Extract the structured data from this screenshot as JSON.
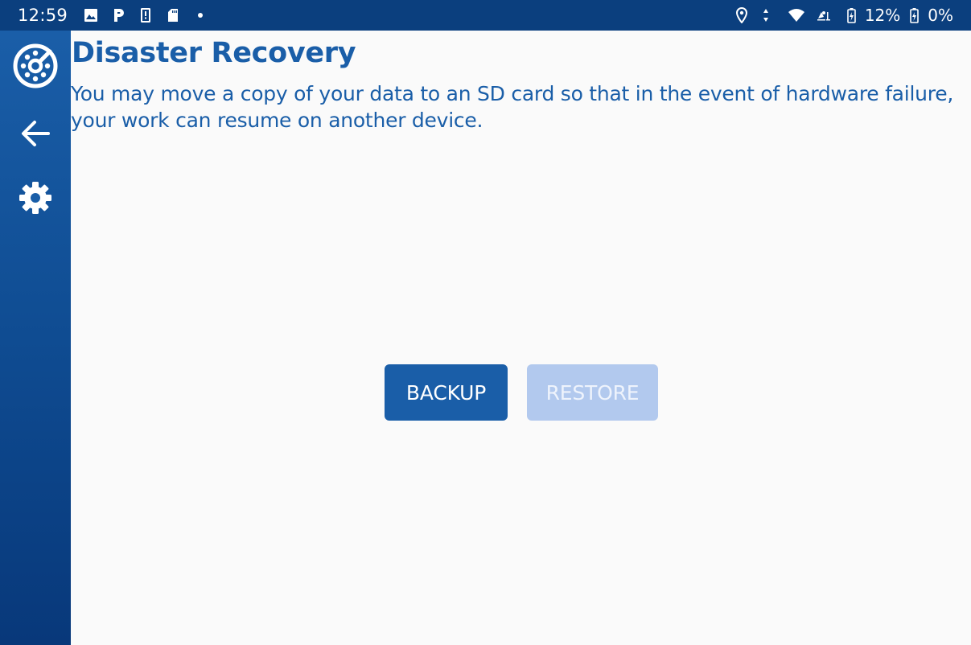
{
  "status_bar": {
    "time": "12:59",
    "notification_icons": [
      "image-icon",
      "parking-icon",
      "device-alert-icon",
      "sd-card-icon",
      "dot-icon"
    ],
    "right_icons": [
      "location-icon",
      "data-transfer-icon",
      "wifi-icon",
      "hotspot-icon",
      "battery-icon",
      "battery-secondary-icon"
    ],
    "battery_primary": "12%",
    "battery_secondary": "0%"
  },
  "sidebar": {
    "items": [
      {
        "name": "dashboard-icon"
      },
      {
        "name": "back-arrow-icon"
      },
      {
        "name": "settings-gear-icon"
      }
    ]
  },
  "main": {
    "title": "Disaster Recovery",
    "description": "You may move a copy of your data to an SD card so that in the event of hardware failure, your work can resume on another device.",
    "backup_label": "BACKUP",
    "restore_label": "RESTORE"
  },
  "colors": {
    "status_bar": "#0b3f7e",
    "sidebar_top": "#1a5ea8",
    "sidebar_bottom": "#08387a",
    "accent": "#1a5ea8",
    "button_disabled": "#b2c9ee",
    "background": "#fafafa"
  }
}
